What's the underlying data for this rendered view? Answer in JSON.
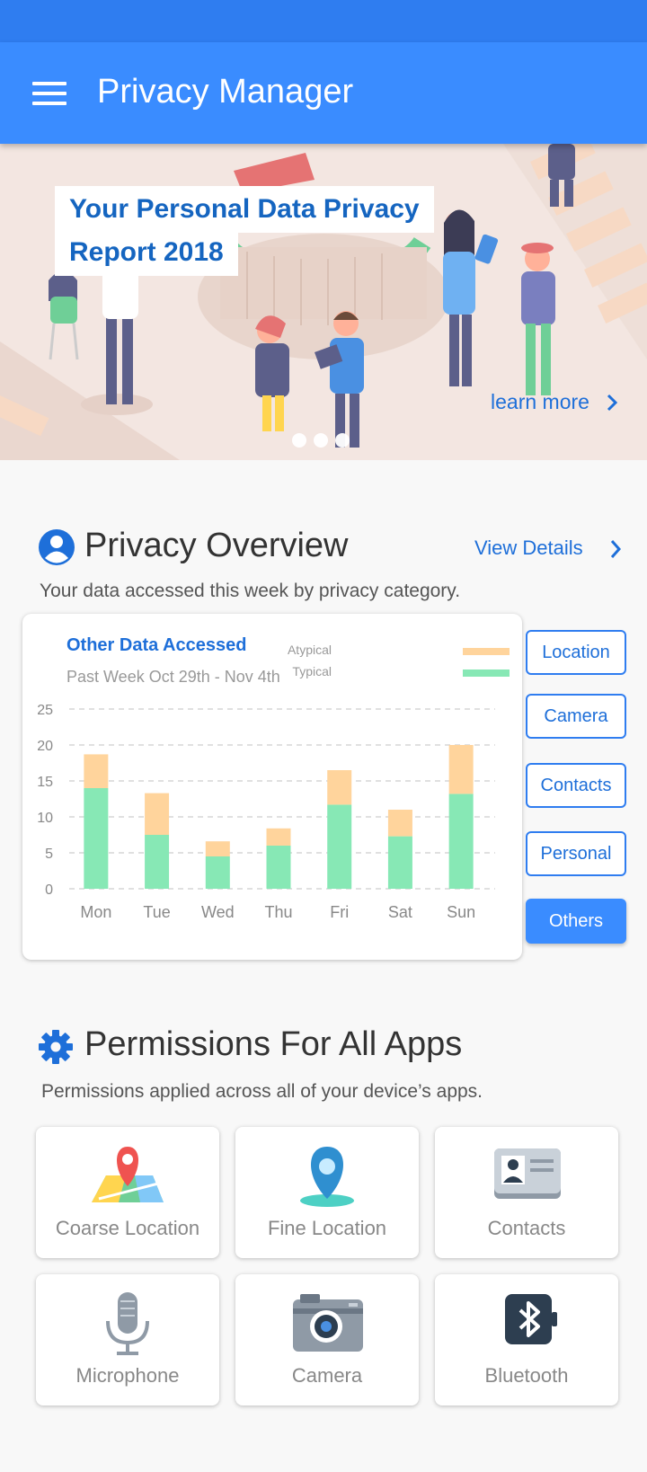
{
  "app": {
    "title": "Privacy Manager"
  },
  "banner": {
    "title_line1": "Your Personal Data Privacy",
    "title_line2": "Report 2018",
    "learn_more": "learn more"
  },
  "overview": {
    "title": "Privacy Overview",
    "view_details": "View Details",
    "subtitle": "Your data accessed this week by privacy category."
  },
  "chart": {
    "title": "Other Data Accessed",
    "subtitle": "Past Week Oct 29th - Nov 4th",
    "legend": {
      "atypical": "Atypical",
      "typical": "Typical"
    },
    "colors": {
      "atypical": "#ffd49c",
      "typical": "#87e8b5"
    }
  },
  "chart_data": {
    "type": "bar",
    "stacked": true,
    "title": "Other Data Accessed",
    "subtitle": "Past Week Oct 29th - Nov 4th",
    "categories": [
      "Mon",
      "Tue",
      "Wed",
      "Thu",
      "Fri",
      "Sat",
      "Sun"
    ],
    "series": [
      {
        "name": "Typical",
        "values": [
          14,
          7.5,
          4.5,
          6,
          11.7,
          7.3,
          13.2
        ]
      },
      {
        "name": "Atypical",
        "values": [
          4.7,
          5.8,
          2.1,
          2.4,
          4.8,
          3.7,
          6.8
        ]
      }
    ],
    "yticks": [
      "25",
      "20",
      "15",
      "10",
      "5",
      "0"
    ],
    "ylim": [
      0,
      25
    ],
    "grid": true,
    "legend_position": "top-right"
  },
  "categories": [
    {
      "label": "Location",
      "active": false
    },
    {
      "label": "Camera",
      "active": false
    },
    {
      "label": "Contacts",
      "active": false
    },
    {
      "label": "Personal",
      "active": false
    },
    {
      "label": "Others",
      "active": true
    }
  ],
  "permissions": {
    "title": "Permissions For All Apps",
    "subtitle": "Permissions applied across all of your device’s apps.",
    "items": [
      {
        "label": "Coarse Location",
        "icon": "map-pin-icon"
      },
      {
        "label": "Fine Location",
        "icon": "location-pin-icon"
      },
      {
        "label": "Contacts",
        "icon": "contact-card-icon"
      },
      {
        "label": "Microphone",
        "icon": "microphone-icon"
      },
      {
        "label": "Camera",
        "icon": "camera-icon"
      },
      {
        "label": "Bluetooth",
        "icon": "bluetooth-icon"
      }
    ]
  }
}
